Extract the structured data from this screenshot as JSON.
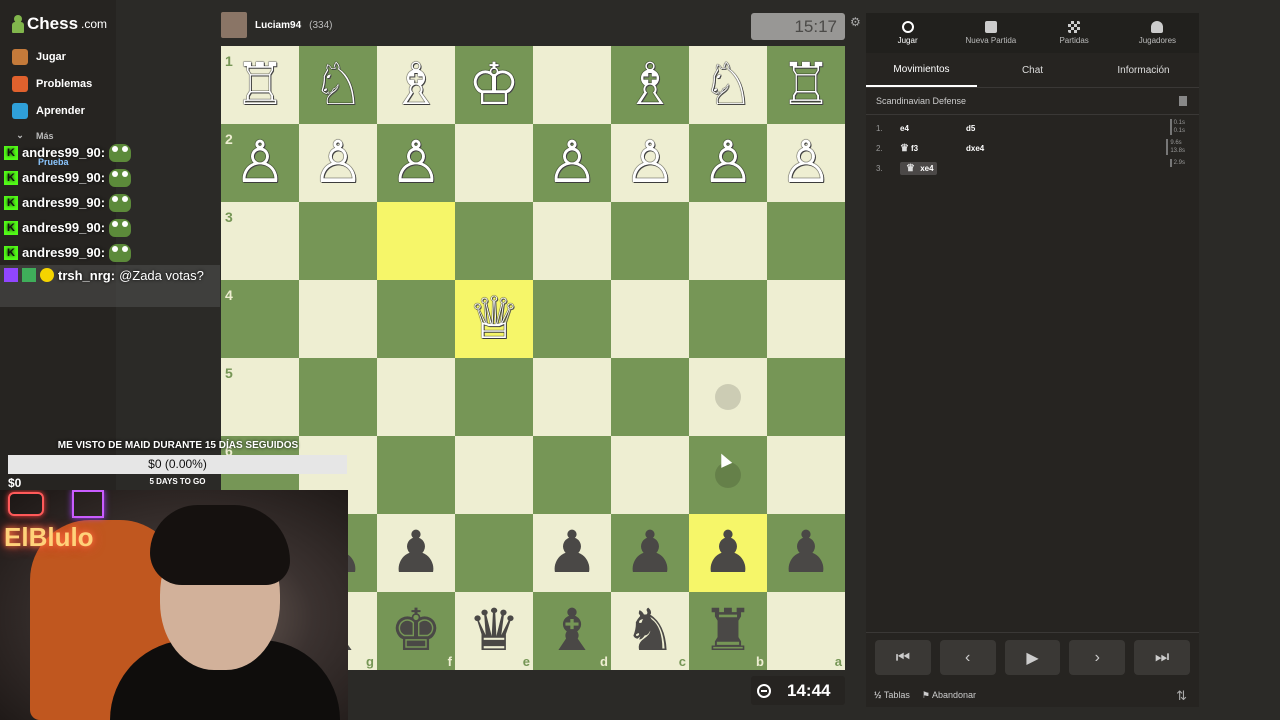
{
  "sidebar": {
    "logo": "Chess",
    "logo_suffix": ".com",
    "items": [
      {
        "label": "Jugar",
        "color": "#c47a3a"
      },
      {
        "label": "Problemas",
        "color": "#e0612d"
      },
      {
        "label": "Aprender",
        "color": "#2f9fd8"
      },
      {
        "label": "Más",
        "color": "#888888"
      }
    ],
    "sub_label": "Prueba"
  },
  "chat": {
    "lines": [
      {
        "user": "andres99_90:"
      },
      {
        "user": "andres99_90:"
      },
      {
        "user": "andres99_90:"
      },
      {
        "user": "andres99_90:"
      },
      {
        "user": "andres99_90:"
      }
    ],
    "twitch": {
      "user": "trsh_nrg:",
      "message": "@Zada votas?"
    }
  },
  "top_player": {
    "name": "Luciam94",
    "rating": "(334)",
    "clock": "15:17"
  },
  "bottom_player": {
    "clock": "14:44"
  },
  "goal": {
    "title": "ME VISTO DE MAID DURANTE 15 DÍAS SEGUIDOS",
    "bar_text": "$0 (0.00%)",
    "progress": 0.0,
    "left_amount": "$0",
    "days_left": "5 DAYS TO GO"
  },
  "webcam": {
    "name": "ElBlulo"
  },
  "board": {
    "rows": [
      [
        "♖",
        "♘",
        "♗",
        "♔",
        "",
        "♗",
        "♘",
        "♖"
      ],
      [
        "♙",
        "♙",
        "♙",
        "",
        "♙",
        "♙",
        "♙",
        "♙"
      ],
      [
        "",
        "",
        "",
        "",
        "",
        "",
        "",
        ""
      ],
      [
        "",
        "",
        "",
        "♕",
        "",
        "",
        "",
        ""
      ],
      [
        "",
        "",
        "",
        "",
        "",
        "",
        "",
        ""
      ],
      [
        "",
        "",
        "",
        "",
        "",
        "",
        "",
        ""
      ],
      [
        "♟",
        "♟",
        "♟",
        "",
        "♟",
        "♟",
        "♟",
        "♟"
      ],
      [
        "♜",
        "♝",
        "♚",
        "♛",
        "♝",
        "♞",
        "♜",
        ""
      ]
    ],
    "ranks": [
      "1",
      "2",
      "3",
      "4",
      "5",
      "6"
    ],
    "files": [
      "g",
      "f",
      "e",
      "d",
      "c",
      "b",
      "a"
    ]
  },
  "panel": {
    "tabs": [
      {
        "label": "Jugar",
        "icon": "stopwatch-icon"
      },
      {
        "label": "Nueva Partida",
        "icon": "plus-icon"
      },
      {
        "label": "Partidas",
        "icon": "board-icon"
      },
      {
        "label": "Jugadores",
        "icon": "users-icon"
      }
    ],
    "subtabs": [
      "Movimientos",
      "Chat",
      "Información"
    ],
    "opening": "Scandinavian Defense",
    "moves": [
      {
        "num": "1.",
        "white": "e4",
        "black": "d5",
        "t1": "0.1s",
        "t2": "0.1s"
      },
      {
        "num": "2.",
        "white": "f3",
        "black": "dxe4",
        "t1": "9.6s",
        "t2": "13.8s"
      },
      {
        "num": "3.",
        "white": "xe4",
        "black": "",
        "t1": "2.9s",
        "t2": ""
      }
    ],
    "footer": {
      "draw": "Tablas",
      "draw_prefix": "½",
      "resign": "Abandonar"
    }
  }
}
